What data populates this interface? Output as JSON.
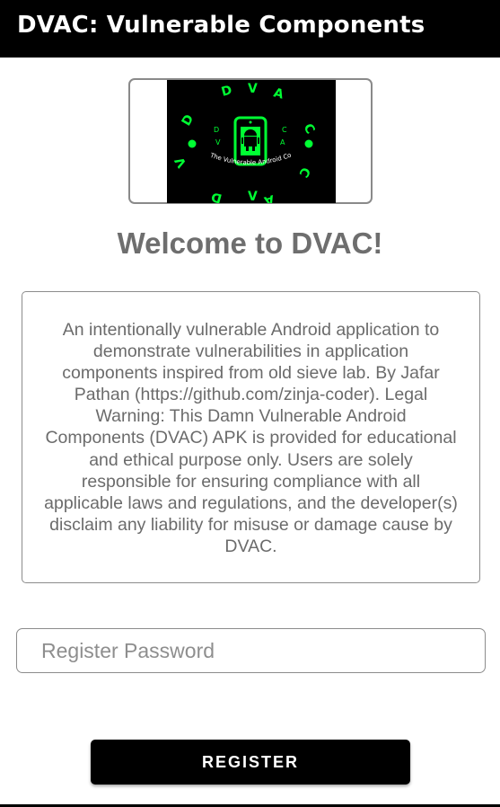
{
  "app_bar": {
    "title": "DVAC: Vulnerable Components"
  },
  "logo": {
    "icon": "dvac-android-logo",
    "ring_letters": [
      "D",
      "V",
      "A",
      "C"
    ],
    "tagline": "The Vulnerable Android Components",
    "colors": {
      "background": "#000000",
      "accent": "#00ff33"
    }
  },
  "welcome_heading": "Welcome to DVAC!",
  "description": "An intentionally vulnerable Android application to demonstrate vulnerabilities in application components inspired from old sieve lab. By Jafar Pathan (https://github.com/zinja-coder). Legal Warning: This Damn Vulnerable Android Components (DVAC) APK is provided for educational and ethical purpose only. Users are solely responsible for ensuring compliance with all applicable laws and regulations, and the developer(s) disclaim any liability for misuse or damage cause by DVAC.",
  "password_field": {
    "value": "",
    "placeholder": "Register Password"
  },
  "register_button": {
    "label": "REGISTER"
  }
}
